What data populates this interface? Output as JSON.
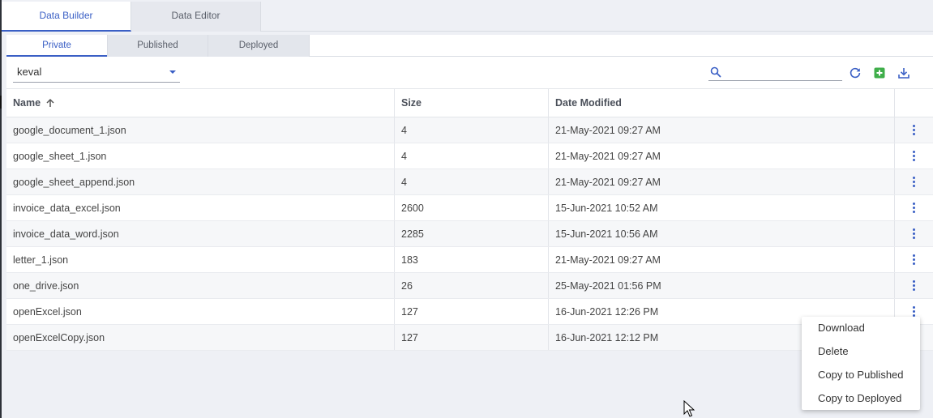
{
  "top_tabs": [
    {
      "label": "Data Builder",
      "active": true
    },
    {
      "label": "Data Editor",
      "active": false
    }
  ],
  "sub_tabs": [
    {
      "label": "Private",
      "active": true
    },
    {
      "label": "Published",
      "active": false
    },
    {
      "label": "Deployed",
      "active": false
    }
  ],
  "toolbar": {
    "user_select_value": "keval",
    "search_value": "",
    "icons": [
      "search-icon",
      "refresh-icon",
      "add-icon",
      "download-icon"
    ]
  },
  "table": {
    "headers": {
      "name": "Name",
      "size": "Size",
      "date": "Date Modified"
    },
    "sort": {
      "column": "Name",
      "direction": "ascending"
    },
    "rows": [
      {
        "name": "google_document_1.json",
        "size": "4",
        "date": "21-May-2021 09:27 AM"
      },
      {
        "name": "google_sheet_1.json",
        "size": "4",
        "date": "21-May-2021 09:27 AM"
      },
      {
        "name": "google_sheet_append.json",
        "size": "4",
        "date": "21-May-2021 09:27 AM"
      },
      {
        "name": "invoice_data_excel.json",
        "size": "2600",
        "date": "15-Jun-2021 10:52 AM"
      },
      {
        "name": "invoice_data_word.json",
        "size": "2285",
        "date": "15-Jun-2021 10:56 AM"
      },
      {
        "name": "letter_1.json",
        "size": "183",
        "date": "21-May-2021 09:27 AM"
      },
      {
        "name": "one_drive.json",
        "size": "26",
        "date": "25-May-2021 01:56 PM"
      },
      {
        "name": "openExcel.json",
        "size": "127",
        "date": "16-Jun-2021 12:26 PM"
      },
      {
        "name": "openExcelCopy.json",
        "size": "127",
        "date": "16-Jun-2021 12:12 PM"
      }
    ]
  },
  "context_menu": {
    "items": [
      "Download",
      "Delete",
      "Copy to Published",
      "Copy to Deployed"
    ]
  },
  "colors": {
    "accent": "#3a5fc5",
    "add_green": "#3fae4a",
    "background": "#eef0f5"
  }
}
